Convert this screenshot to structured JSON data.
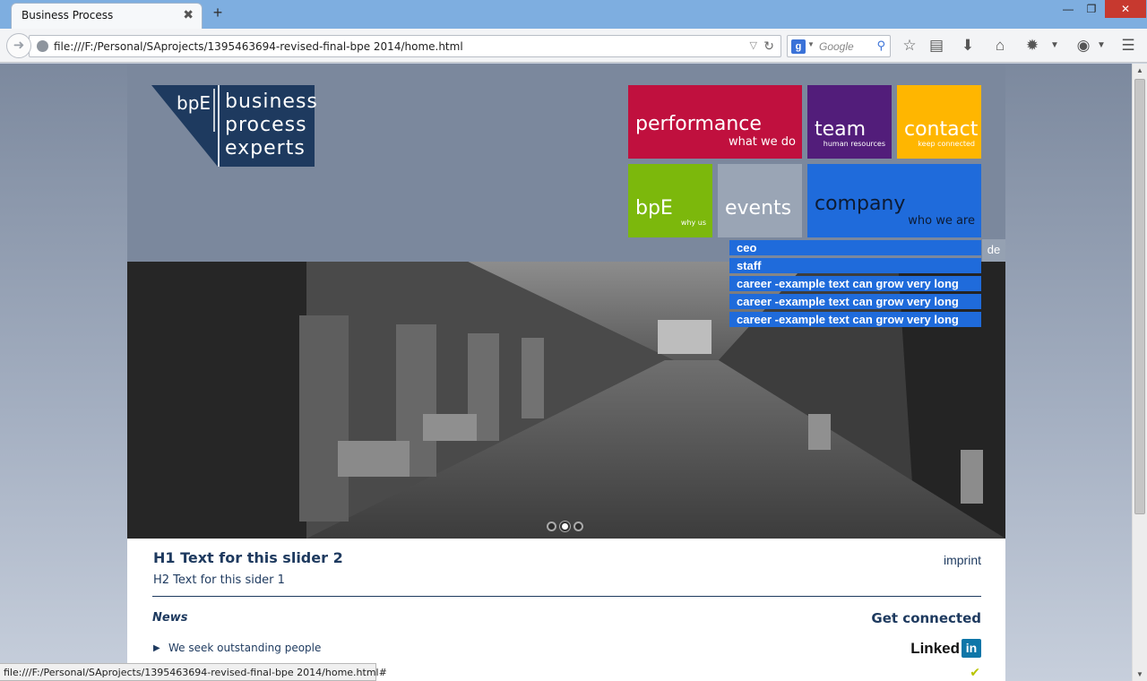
{
  "browser": {
    "tab_title": "Business Process",
    "tab_close": "✖",
    "new_tab": "+",
    "url": "file:///F:/Personal/SAprojects/1395463694-revised-final-bpe 2014/home.html",
    "search_placeholder": "Google",
    "status_url": "file:///F:/Personal/SAprojects/1395463694-revised-final-bpe 2014/home.html#"
  },
  "logo": {
    "mark": "bpE",
    "lines": [
      "business",
      "process",
      "experts"
    ]
  },
  "nav_tiles": [
    {
      "title": "performance",
      "subtitle": "what we do",
      "color": "#c0103e"
    },
    {
      "title": "team",
      "subtitle": "human resources",
      "color": "#521d7a"
    },
    {
      "title": "contact",
      "subtitle": "keep connected",
      "color": "#ffb600"
    },
    {
      "title": "bpE",
      "subtitle": "why us",
      "color": "#7cb80c"
    },
    {
      "title": "events",
      "subtitle": "",
      "color": "#9aa5b5"
    },
    {
      "title": "company",
      "subtitle": "who we are",
      "color": "#1f6bdb"
    }
  ],
  "language": "de",
  "company_menu": [
    "ceo",
    "staff",
    "career -example text can grow very long",
    "career -example text can grow very long",
    "career -example text can grow very long"
  ],
  "slider": {
    "dot_count": 3,
    "active_dot": 2
  },
  "content": {
    "h1": "H1 Text for this slider 2",
    "h2": "H2 Text for this sider 1",
    "imprint": "imprint",
    "news_title": "News",
    "news_items": [
      "We seek outstanding people"
    ],
    "get_connected": "Get connected",
    "linkedin_text": "Linked",
    "linkedin_box": "in"
  }
}
